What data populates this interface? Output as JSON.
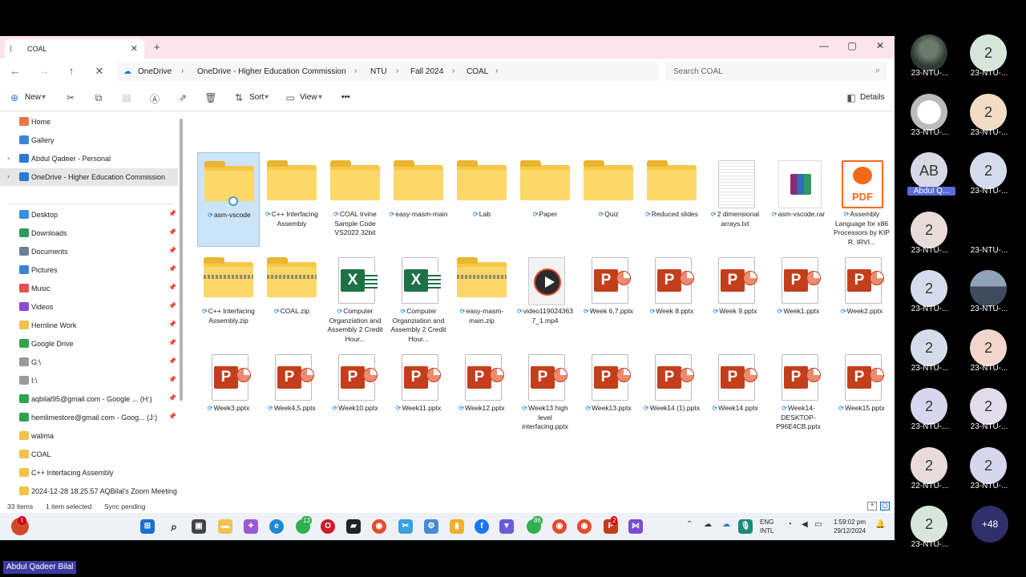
{
  "window": {
    "tab_title": "COAL",
    "new_tab": "+",
    "controls": {
      "minimize": "—",
      "maximize": "▢",
      "close": "✕"
    }
  },
  "address": {
    "crumbs": [
      "OneDrive",
      "OneDrive - Higher Education Commission",
      "NTU",
      "Fall 2024",
      "COAL"
    ],
    "search_placeholder": "Search COAL"
  },
  "toolbar": {
    "new_label": "New",
    "sort_label": "Sort",
    "view_label": "View",
    "more_label": "•••",
    "details_label": "Details"
  },
  "sidebar": {
    "items": [
      {
        "label": "Home",
        "icon": "home-icon",
        "color": "#e8764a"
      },
      {
        "label": "Gallery",
        "icon": "gallery-icon",
        "color": "#3a86d4"
      },
      {
        "label": "Abdul Qadeer - Personal",
        "icon": "cloud-icon",
        "color": "#2a7ad4"
      },
      {
        "label": "OneDrive - Higher Education Commission",
        "icon": "cloud-icon",
        "color": "#2a7ad4",
        "selected": true
      },
      {
        "label": "Desktop",
        "icon": "desktop-icon",
        "color": "#3a8ee6"
      },
      {
        "label": "Downloads",
        "icon": "download-icon",
        "color": "#2f9b5a"
      },
      {
        "label": "Documents",
        "icon": "documents-icon",
        "color": "#6e7f9a"
      },
      {
        "label": "Pictures",
        "icon": "pictures-icon",
        "color": "#3a86d4"
      },
      {
        "label": "Music",
        "icon": "music-icon",
        "color": "#e0544e"
      },
      {
        "label": "Videos",
        "icon": "videos-icon",
        "color": "#8a4ad4"
      },
      {
        "label": "Hemline Work",
        "icon": "folder-icon",
        "color": "#f2c24b"
      },
      {
        "label": "Google Drive",
        "icon": "drive-icon",
        "color": "#2fa44f"
      },
      {
        "label": "G:\\",
        "icon": "drive-icon",
        "color": "#9a9a9a"
      },
      {
        "label": "I:\\",
        "icon": "drive-icon",
        "color": "#9a9a9a"
      },
      {
        "label": "aqbilal95@gmail.com - Google ... (H:)",
        "icon": "drive-icon",
        "color": "#2fa44f"
      },
      {
        "label": "hemlimestore@gmail.com - Goog... (J:)",
        "icon": "drive-icon",
        "color": "#2fa44f"
      },
      {
        "label": "walima",
        "icon": "folder-icon",
        "color": "#f2c24b"
      },
      {
        "label": "COAL",
        "icon": "folder-icon",
        "color": "#f2c24b"
      },
      {
        "label": "C++ Interfacing Assembly",
        "icon": "folder-icon",
        "color": "#f2c24b"
      },
      {
        "label": "2024-12-28 18.25.57 AQBilal's Zoom Meeting",
        "icon": "folder-icon",
        "color": "#f2c24b"
      }
    ]
  },
  "files": [
    {
      "name": "asm-vscode",
      "type": "folder",
      "selected": true
    },
    {
      "name": "C++ Interfacing Assembly",
      "type": "folder"
    },
    {
      "name": "COAL Irvine Sample Code VS2022 32bit",
      "type": "folder"
    },
    {
      "name": "easy-masm-main",
      "type": "folder"
    },
    {
      "name": "Lab",
      "type": "folder"
    },
    {
      "name": "Paper",
      "type": "folder"
    },
    {
      "name": "Quiz",
      "type": "folder"
    },
    {
      "name": "Reduced slides",
      "type": "folder"
    },
    {
      "name": "2 dimensional arrays.txt",
      "type": "txt"
    },
    {
      "name": "asm-vscode.rar",
      "type": "rar"
    },
    {
      "name": "Assembly Language for x86 Processors by KIP R. IRVI...",
      "type": "pdf"
    },
    {
      "name": "C++ Interfacing Assembly.zip",
      "type": "zip"
    },
    {
      "name": "COAL.zip",
      "type": "zip"
    },
    {
      "name": "Computer Organziation and Assembly 2 Credit Hour...",
      "type": "xlsx"
    },
    {
      "name": "Computer Organziation and Assembly 2 Credit Hour...",
      "type": "xlsx"
    },
    {
      "name": "easy-masm-main.zip",
      "type": "zip"
    },
    {
      "name": "video1190243637_1.mp4",
      "type": "mp4"
    },
    {
      "name": "Week 6,7.pptx",
      "type": "pptx"
    },
    {
      "name": "Week 8.pptx",
      "type": "pptx"
    },
    {
      "name": "Week 9.pptx",
      "type": "pptx"
    },
    {
      "name": "Week1.pptx",
      "type": "pptx"
    },
    {
      "name": "Week2.pptx",
      "type": "pptx"
    },
    {
      "name": "Week3.pptx",
      "type": "pptx"
    },
    {
      "name": "Week4,5.pptx",
      "type": "pptx"
    },
    {
      "name": "Week10.pptx",
      "type": "pptx"
    },
    {
      "name": "Week11.pptx",
      "type": "pptx"
    },
    {
      "name": "Week12.pptx",
      "type": "pptx"
    },
    {
      "name": "Week13 high level interfacing.pptx",
      "type": "pptx"
    },
    {
      "name": "Week13.pptx",
      "type": "pptx"
    },
    {
      "name": "Week14 (1).pptx",
      "type": "pptx"
    },
    {
      "name": "Week14.pptx",
      "type": "pptx"
    },
    {
      "name": "Week14-DESKTOP-P96E4CB.pptx",
      "type": "pptx"
    },
    {
      "name": "Week15.pptx",
      "type": "pptx"
    }
  ],
  "file_labels": {
    "ppt": "P",
    "xls": "X",
    "pdf": "PDF"
  },
  "status": {
    "count": "33 items",
    "selection": "1 item selected",
    "sync": "Sync pending"
  },
  "taskbar": {
    "weather_badge": "1",
    "whatsapp_badge": "13",
    "whatsapp2_badge": "86",
    "chrome_badge": "2",
    "lang_top": "ENG",
    "lang_bottom": "INTL",
    "time": "1:59:02 pm",
    "date": "29/12/2024"
  },
  "participants": [
    {
      "name": "23-NTU-...",
      "initial": "",
      "style": "photo"
    },
    {
      "name": "23-NTU-...",
      "initial": "2",
      "bg": "#d6e6d8"
    },
    {
      "name": "23-NTU-...",
      "initial": "",
      "style": "troll"
    },
    {
      "name": "23-NTU-...",
      "initial": "2",
      "bg": "#f2dcc4"
    },
    {
      "name": "Abdul Q...",
      "initial": "AB",
      "bg": "#d9d9e6",
      "highlight": true
    },
    {
      "name": "23-NTU-...",
      "initial": "2",
      "bg": "#d4dcec"
    },
    {
      "name": "23-NTU-...",
      "initial": "2",
      "bg": "#e8dcd8"
    },
    {
      "name": "23-NTU-...",
      "initial": "",
      "style": "dark"
    },
    {
      "name": "23-NTU-...",
      "initial": "2",
      "bg": "#d4dcec"
    },
    {
      "name": "23-NTU-...",
      "initial": "",
      "style": "city"
    },
    {
      "name": "23-NTU-...",
      "initial": "2",
      "bg": "#d4dcec"
    },
    {
      "name": "23-NTU-...",
      "initial": "2",
      "bg": "#f2d6cc"
    },
    {
      "name": "23-NTU-...",
      "initial": "2",
      "bg": "#d8d6ec"
    },
    {
      "name": "23-NTU-...",
      "initial": "2",
      "bg": "#e2dcec"
    },
    {
      "name": "22-NTU-...",
      "initial": "2",
      "bg": "#e8dcd8"
    },
    {
      "name": "23-NTU-...",
      "initial": "2",
      "bg": "#d8d6ec"
    },
    {
      "name": "23-NTU-...",
      "initial": "2",
      "bg": "#d6e6d8"
    }
  ],
  "more_participants": "+48",
  "active_speaker": "Abdul Qadeer Bilal"
}
